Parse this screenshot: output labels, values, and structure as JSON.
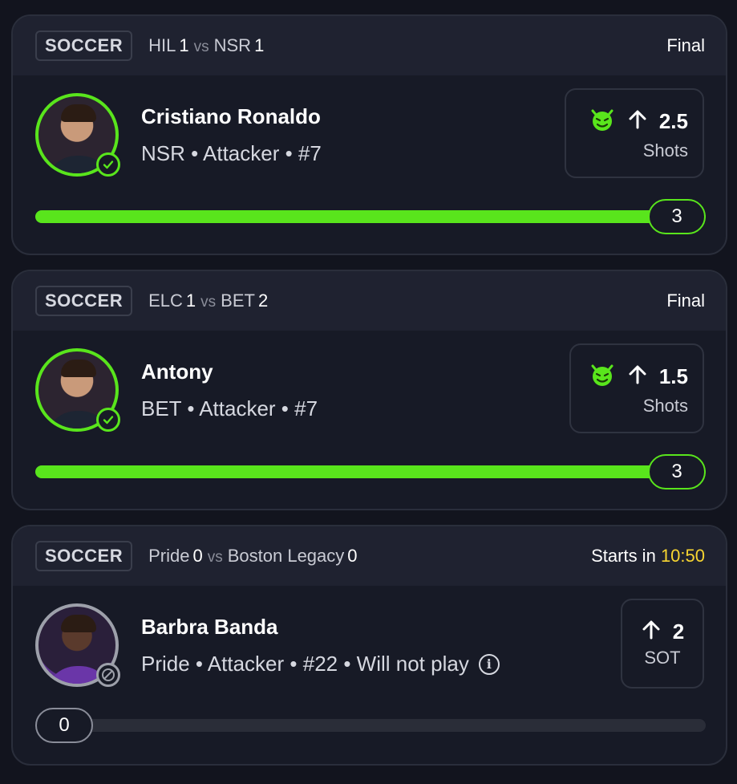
{
  "colors": {
    "accent_green": "#59e51c",
    "countdown_yellow": "#f7d531",
    "background": "#12141e"
  },
  "cards": [
    {
      "sport": "SOCCER",
      "team1": "HIL",
      "score1": "1",
      "vs": "vs",
      "team2": "NSR",
      "score2": "1",
      "status": "Final",
      "countdown": "",
      "player_name": "Cristiano Ronaldo",
      "player_meta": "NSR • Attacker • #7",
      "line_icon": "demon-icon",
      "direction_icon": "arrow-up-icon",
      "line_value": "2.5",
      "line_stat": "Shots",
      "result": "3",
      "progress_fraction": 1.0,
      "player_status": "check-icon"
    },
    {
      "sport": "SOCCER",
      "team1": "ELC",
      "score1": "1",
      "vs": "vs",
      "team2": "BET",
      "score2": "2",
      "status": "Final",
      "countdown": "",
      "player_name": "Antony",
      "player_meta": "BET • Attacker • #7",
      "line_icon": "demon-icon",
      "direction_icon": "arrow-up-icon",
      "line_value": "1.5",
      "line_stat": "Shots",
      "result": "3",
      "progress_fraction": 1.0,
      "player_status": "check-icon"
    },
    {
      "sport": "SOCCER",
      "team1": "Pride",
      "score1": "0",
      "vs": "vs",
      "team2": "Boston Legacy",
      "score2": "0",
      "status": "Starts in",
      "countdown": "10:50",
      "player_name": "Barbra Banda",
      "player_meta": "Pride • Attacker • #22 • Will not play",
      "direction_icon": "arrow-up-icon",
      "line_value": "2",
      "line_stat": "SOT",
      "result": "0",
      "progress_fraction": 0.0,
      "player_status": "not-playing-icon"
    }
  ]
}
